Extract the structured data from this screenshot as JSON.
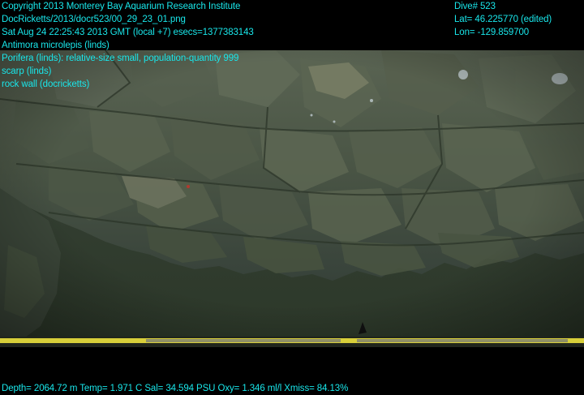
{
  "overlay_left": [
    "Copyright 2013 Monterey Bay Aquarium Research Institute",
    "DocRicketts/2013/docr523/00_29_23_01.png",
    "Sat Aug 24 22:25:43 2013 GMT (local +7)  esecs=1377383143",
    "Antimora microlepis (linds)",
    "Porifera (linds): relative-size small, population-quantity 999",
    "scarp (linds)",
    "rock wall (docricketts)"
  ],
  "overlay_right": [
    "Dive# 523",
    "Lat= 46.225770 (edited)",
    "Lon= -129.859700"
  ],
  "overlay_bottom": "Depth= 2064.72 m  Temp= 1.971 C  Sal= 34.594 PSU  Oxy= 1.346 ml/l  Xmiss= 84.13%",
  "colors": {
    "overlay_text": "#19e6ea",
    "water": "#2f3a2c",
    "rock": "#4a5546",
    "sample_tray": "#d8cf3a"
  }
}
